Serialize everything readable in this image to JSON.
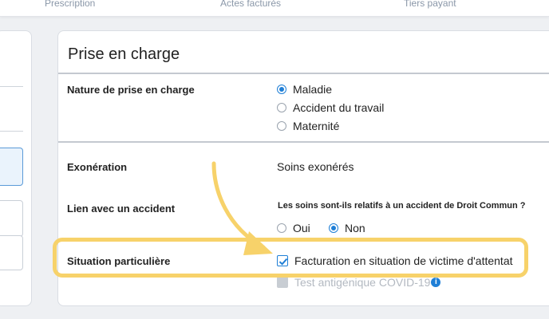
{
  "tabs": [
    "Prescription",
    "Actes facturés",
    "Tiers payant"
  ],
  "section": {
    "title": "Prise en charge",
    "nature": {
      "label": "Nature de prise en charge",
      "options": [
        "Maladie",
        "Accident du travail",
        "Maternité"
      ],
      "selected": "Maladie"
    },
    "exoneration": {
      "label": "Exonération",
      "value": "Soins exonérés"
    },
    "accident": {
      "label": "Lien avec un accident",
      "question": "Les soins sont-ils relatifs à un accident de Droit Commun ?",
      "options": [
        "Oui",
        "Non"
      ],
      "selected": "Non"
    },
    "situation": {
      "label": "Situation particulière",
      "options": [
        {
          "text": "Facturation en situation de victime d'attentat",
          "checked": true,
          "disabled": false
        },
        {
          "text": "Test antigénique COVID-19",
          "checked": false,
          "disabled": true
        }
      ]
    }
  },
  "colors": {
    "accent": "#1f7fd6",
    "highlight": "#f7d26a"
  },
  "icons": {
    "info": "info-icon",
    "arrow": "annotation-arrow-icon",
    "check": "checkmark-icon"
  }
}
